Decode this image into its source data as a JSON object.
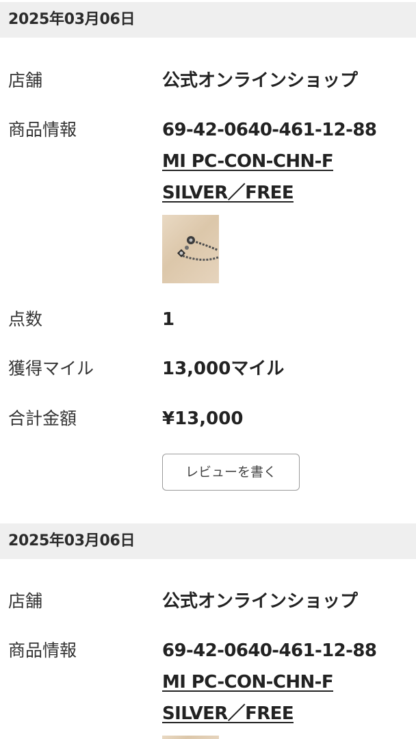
{
  "orders": [
    {
      "date": "2025年03月06日",
      "store_label": "店舗",
      "store_value": "公式オンラインショップ",
      "product_label": "商品情報",
      "product_lines": [
        "69-42-0640-461-12-88",
        "MI PC-CON-CHN-F",
        "SILVER／FREE"
      ],
      "quantity_label": "点数",
      "quantity_value": "1",
      "miles_label": "獲得マイル",
      "miles_value": "13,000マイル",
      "total_label": "合計金額",
      "total_value": "¥13,000",
      "review_button": "レビューを書く"
    },
    {
      "date": "2025年03月06日",
      "store_label": "店舗",
      "store_value": "公式オンラインショップ",
      "product_label": "商品情報",
      "product_lines": [
        "69-42-0640-461-12-88",
        "MI PC-CON-CHN-F",
        "SILVER／FREE"
      ]
    }
  ],
  "icons": {
    "product_thumbnail": "silver-chain-earring-photo"
  },
  "colors": {
    "date_bar_bg": "#efefef",
    "text": "#222222",
    "button_border": "#9a9a9a"
  }
}
